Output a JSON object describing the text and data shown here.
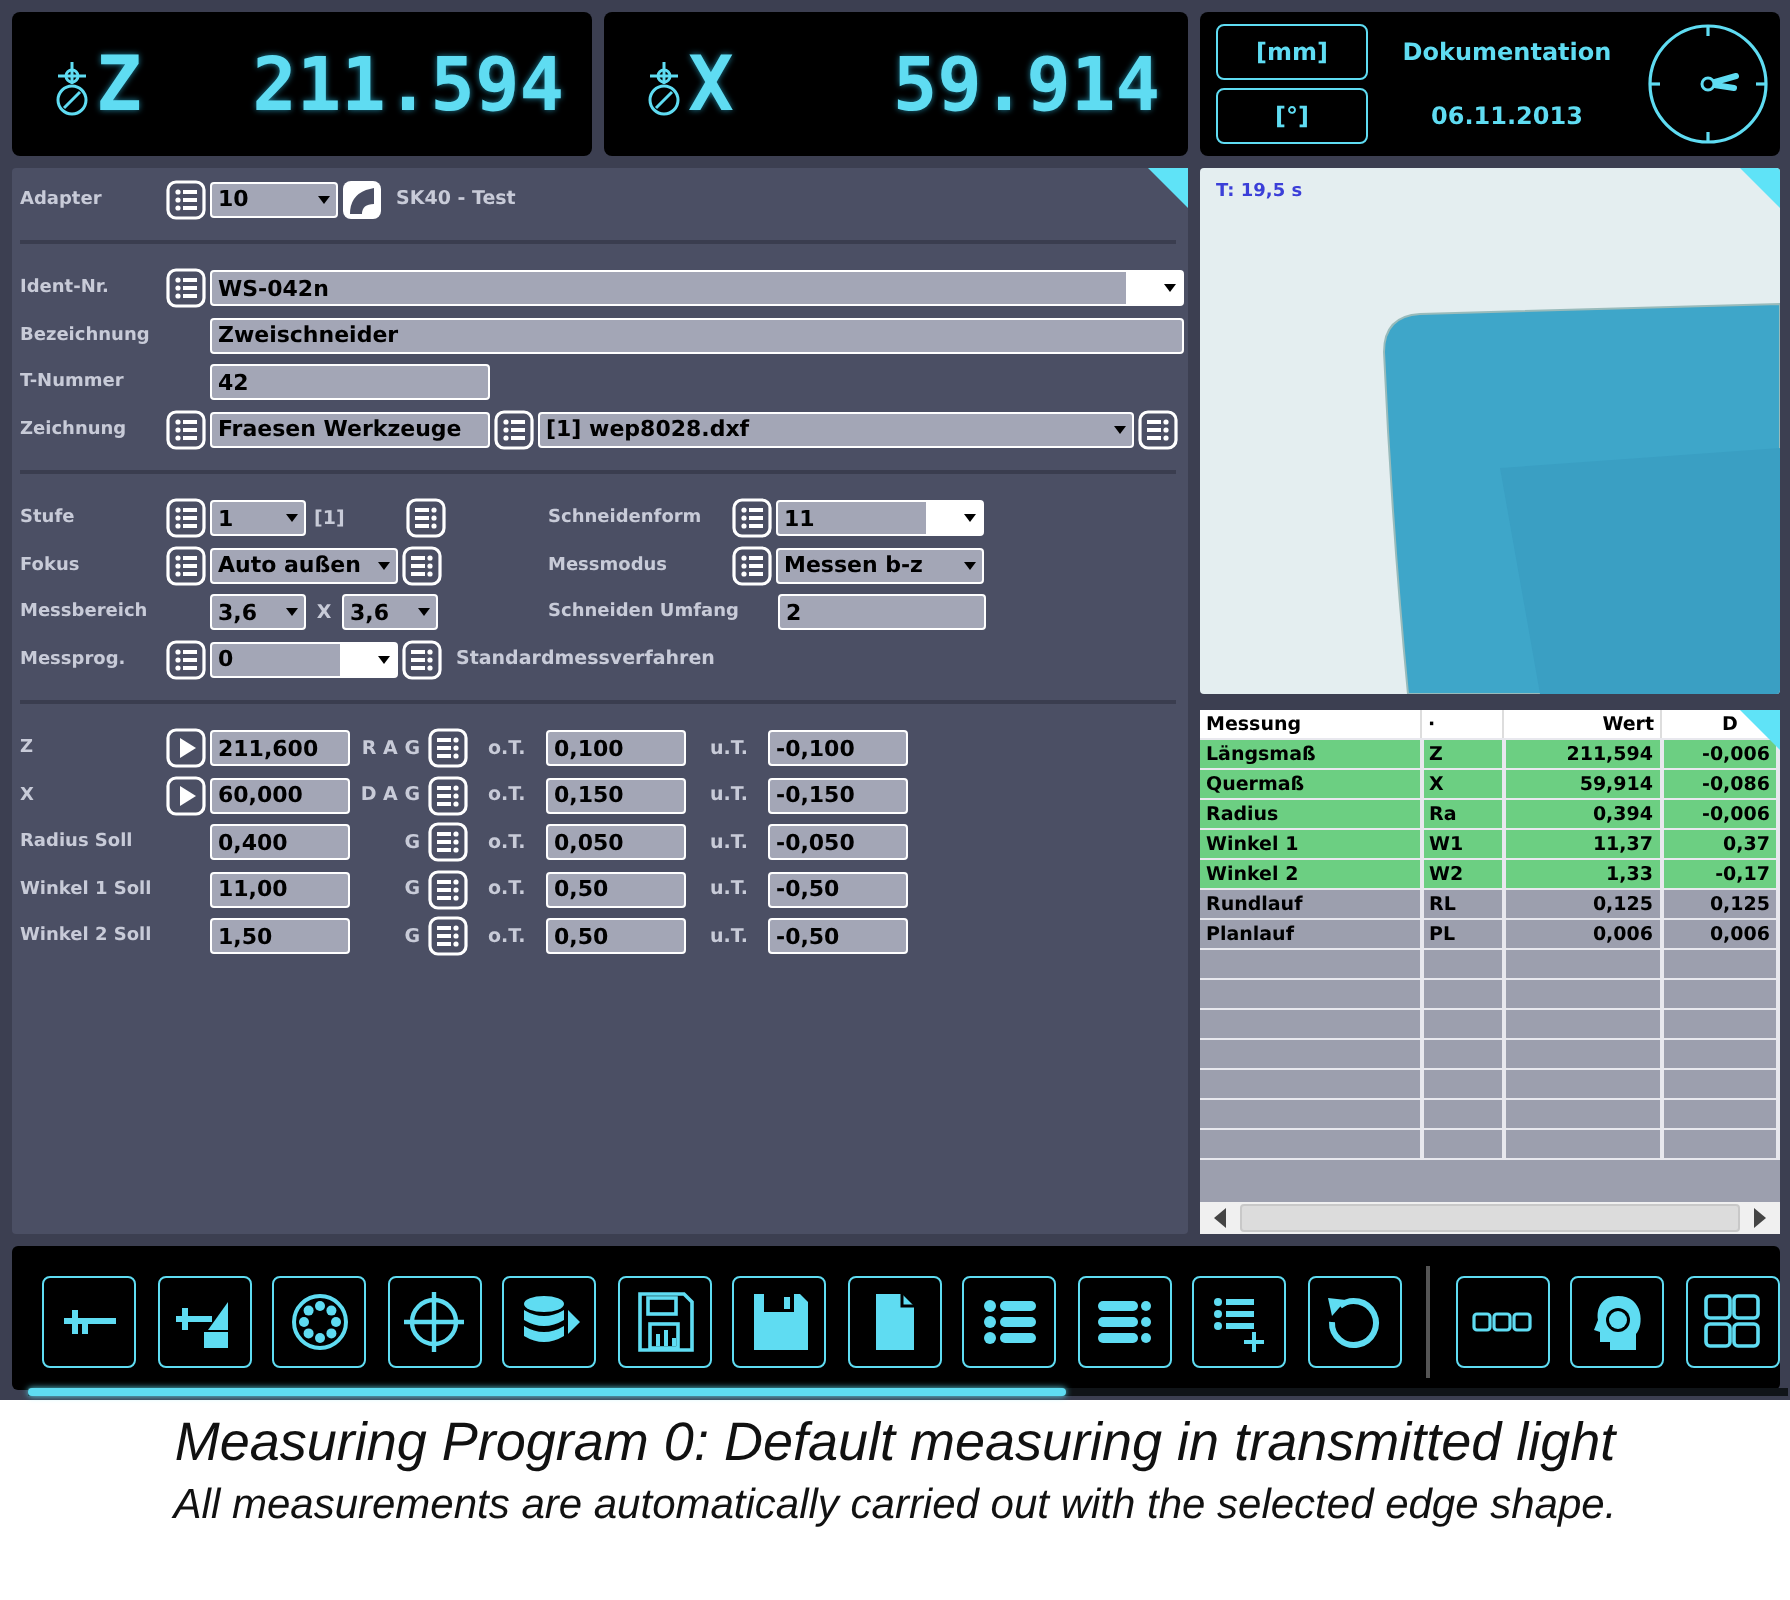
{
  "readouts": [
    {
      "axis": "Z",
      "value": "211.594"
    },
    {
      "axis": "X",
      "value": "59.914"
    }
  ],
  "info": {
    "units": [
      "[mm]",
      "[°]"
    ],
    "title": "Dokumentation",
    "date": "06.11.2013"
  },
  "adapter": {
    "label": "Adapter",
    "value": "10",
    "description": "SK40 - Test"
  },
  "tool": {
    "ident": {
      "label": "Ident-Nr.",
      "value": "WS-042n"
    },
    "name": {
      "label": "Bezeichnung",
      "value": "Zweischneider"
    },
    "t_number": {
      "label": "T-Nummer",
      "value": "42"
    },
    "drawing": {
      "label": "Zeichnung",
      "group": "Fraesen Werkzeuge",
      "file": "[1] wep8028.dxf"
    }
  },
  "settings": {
    "stufe": {
      "label": "Stufe",
      "value": "1",
      "note": "[1]"
    },
    "fokus": {
      "label": "Fokus",
      "value": "Auto außen"
    },
    "messbereich": {
      "label": "Messbereich",
      "value_1": "3,6",
      "separator": "X",
      "value_2": "3,6"
    },
    "messprog": {
      "label": "Messprog.",
      "value": "0",
      "description": "Standardmessverfahren"
    },
    "schneidenform": {
      "label": "Schneidenform",
      "value": "11"
    },
    "messmodus": {
      "label": "Messmodus",
      "value": "Messen b-z"
    },
    "schneiden_umfang": {
      "label": "Schneiden Umfang",
      "value": "2"
    }
  },
  "targets": [
    {
      "label": "Z",
      "has_play": true,
      "nominal": "211,600",
      "flags": "R A G",
      "upper_label": "o.T.",
      "upper": "0,100",
      "lower_label": "u.T.",
      "lower": "-0,100"
    },
    {
      "label": "X",
      "has_play": true,
      "nominal": "60,000",
      "flags": "D A G",
      "upper_label": "o.T.",
      "upper": "0,150",
      "lower_label": "u.T.",
      "lower": "-0,150"
    },
    {
      "label": "Radius Soll",
      "has_play": false,
      "nominal": "0,400",
      "flags": "G",
      "upper_label": "o.T.",
      "upper": "0,050",
      "lower_label": "u.T.",
      "lower": "-0,050"
    },
    {
      "label": "Winkel 1 Soll",
      "has_play": false,
      "nominal": "11,00",
      "flags": "G",
      "upper_label": "o.T.",
      "upper": "0,50",
      "lower_label": "u.T.",
      "lower": "-0,50"
    },
    {
      "label": "Winkel 2 Soll",
      "has_play": false,
      "nominal": "1,50",
      "flags": "G",
      "upper_label": "o.T.",
      "upper": "0,50",
      "lower_label": "u.T.",
      "lower": "-0,50"
    }
  ],
  "camera": {
    "time": "T: 19,5 s"
  },
  "table": {
    "columns": [
      "Messung",
      "·",
      "Wert",
      "D"
    ],
    "rows": [
      {
        "cells": [
          "Längsmaß",
          "Z",
          "211,594",
          "-0,006"
        ],
        "in_tolerance": true
      },
      {
        "cells": [
          "Quermaß",
          "X",
          "59,914",
          "-0,086"
        ],
        "in_tolerance": true
      },
      {
        "cells": [
          "Radius",
          "Ra",
          "0,394",
          "-0,006"
        ],
        "in_tolerance": true
      },
      {
        "cells": [
          "Winkel 1",
          "W1",
          "11,37",
          "0,37"
        ],
        "in_tolerance": true
      },
      {
        "cells": [
          "Winkel 2",
          "W2",
          "1,33",
          "-0,17"
        ],
        "in_tolerance": true
      },
      {
        "cells": [
          "Rundlauf",
          "RL",
          "0,125",
          "0,125"
        ],
        "in_tolerance": false
      },
      {
        "cells": [
          "Planlauf",
          "PL",
          "0,006",
          "0,006"
        ],
        "in_tolerance": false
      }
    ]
  },
  "toolbar": {
    "progress": {
      "level": 0.59
    }
  },
  "caption": {
    "title": "Measuring Program 0: Default measuring in transmitted light",
    "subtitle": "All measurements are automatically carried out with the selected edge shape."
  }
}
